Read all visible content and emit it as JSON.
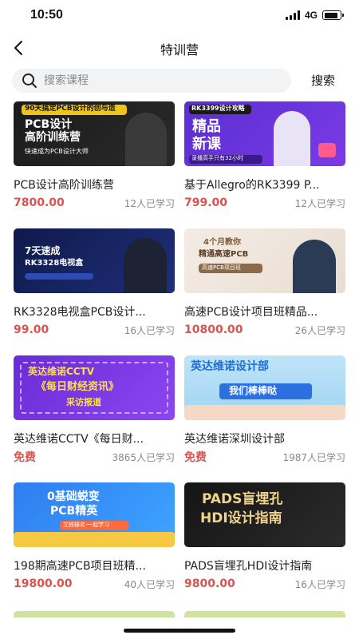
{
  "status_bar": {
    "time": "10:50",
    "network": "4G",
    "battery_level": 0.85
  },
  "nav": {
    "title": "特训营",
    "back_icon": "chevron-left-icon"
  },
  "search": {
    "placeholder": "搜索课程",
    "button_label": "搜索",
    "icon": "search-icon"
  },
  "courses": [
    {
      "title": "PCB设计高阶训练营",
      "price": "7800.00",
      "learners": "12人已学习",
      "banner": [
        "90天搞定PCB设计的创与造",
        "PCB设计",
        "高阶训练营",
        "快速成为PCB设计大师"
      ],
      "theme": "dark"
    },
    {
      "title": "基于Allegro的RK3399 P...",
      "price": "799.00",
      "learners": "12人已学习",
      "banner": [
        "RK3399设计攻略",
        "精品",
        "新课",
        "录播高手只有32小时"
      ],
      "theme": "purple"
    },
    {
      "title": "RK3328电视盒PCB设计...",
      "price": "99.00",
      "learners": "16人已学习",
      "banner": [
        "7天速成",
        "RK3328电视盒"
      ],
      "theme": "navy"
    },
    {
      "title": "高速PCB设计项目班精品...",
      "price": "10800.00",
      "learners": "26人已学习",
      "banner": [
        "4个月教你",
        "精通高速PCB",
        "高速PCB项目班"
      ],
      "theme": "light"
    },
    {
      "title": "英达维诺CCTV《每日财...",
      "price": "免费",
      "learners": "3865人已学习",
      "banner": [
        "英达维诺CCTV",
        "《每日财经资讯》",
        "采访报道"
      ],
      "theme": "violet"
    },
    {
      "title": "英达维诺深圳设计部",
      "price": "免费",
      "learners": "1987人已学习",
      "banner": [
        "英达维诺设计部",
        "我们棒棒哒"
      ],
      "theme": "sky"
    },
    {
      "title": "198期高速PCB项目班精...",
      "price": "19800.00",
      "learners": "40人已学习",
      "banner": [
        "0基础蜕变",
        "PCB精英",
        "立即报名·一起学习"
      ],
      "theme": "blue"
    },
    {
      "title": "PADS盲埋孔HDI设计指南",
      "price": "9800.00",
      "learners": "16人已学习",
      "banner": [
        "PADS盲埋孔",
        "HDI设计指南"
      ],
      "theme": "black"
    }
  ],
  "colors": {
    "price": "#d9534f",
    "search_bg": "#f2f3f5",
    "muted": "#888888"
  }
}
